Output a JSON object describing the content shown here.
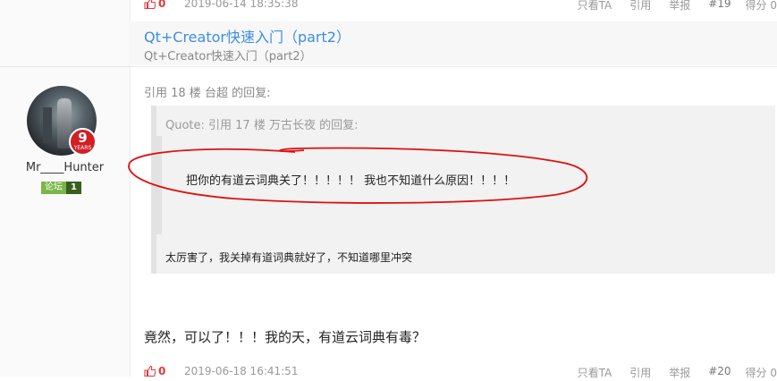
{
  "top_bar": {
    "likes": "0",
    "timestamp": "2019-06-14 18:35:38",
    "only_view": "只看TA",
    "quote": "引用",
    "report": "举报",
    "floor": "#19",
    "score": "得分 0"
  },
  "signature": {
    "title": "Qt+Creator快速入门（part2）",
    "subtitle": "Qt+Creator快速入门（part2）"
  },
  "user": {
    "years": "9",
    "years_label": "YEARS",
    "name": "Mr____Hunter",
    "level_name": "论坛",
    "level": "1"
  },
  "post": {
    "reply_header": "引用 18 楼 台超 的回复:",
    "quote_header": "Quote: 引用 17 楼 万古长夜 的回复:",
    "quoted_text": "把你的有道云词典关了！！！！！ 我也不知道什么原因！！！！",
    "quote_reply": "太厉害了，我关掉有道词典就好了，不知道哪里冲突",
    "body": "竟然，可以了！！！我的天，有道云词典有毒？"
  },
  "bottom_bar": {
    "likes": "0",
    "timestamp": "2019-06-18 16:41:51",
    "only_view": "只看TA",
    "quote": "引用",
    "report": "举报",
    "floor": "#20",
    "score": "得分 0"
  },
  "colors": {
    "accent_link": "#3a8ee6",
    "like_red": "#e4393c",
    "annotation_red": "#e01010"
  }
}
